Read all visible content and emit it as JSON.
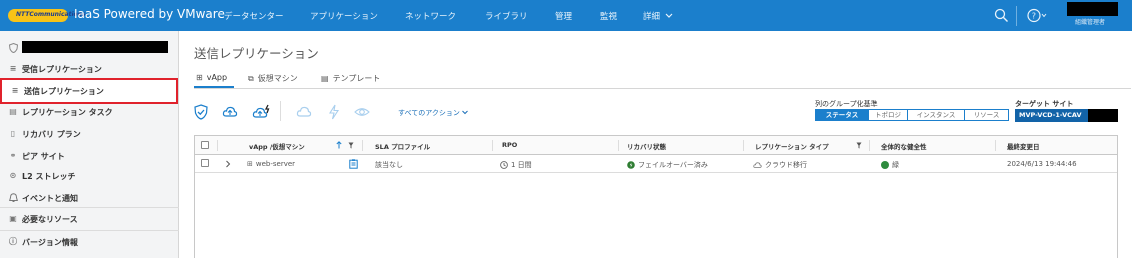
{
  "header": {
    "logo_text": "NTTCommunications",
    "app_title": "IaaS Powered by VMware",
    "nav": [
      "データセンター",
      "アプリケーション",
      "ネットワーク",
      "ライブラリ",
      "管理",
      "監視",
      "詳細"
    ],
    "user_role": "組織管理者"
  },
  "sidebar": {
    "items": [
      {
        "label": "受信レプリケーション",
        "icon": "inbound-icon"
      },
      {
        "label": "送信レプリケーション",
        "icon": "outbound-icon"
      },
      {
        "label": "レプリケーション タスク",
        "icon": "task-icon"
      },
      {
        "label": "リカバリ プラン",
        "icon": "plan-icon"
      },
      {
        "label": "ピア サイト",
        "icon": "peer-icon"
      },
      {
        "label": "L2 ストレッチ",
        "icon": "stretch-icon"
      },
      {
        "label": "イベントと通知",
        "icon": "bell-icon"
      },
      {
        "label": "必要なリソース",
        "icon": "resource-icon"
      },
      {
        "label": "バージョン情報",
        "icon": "info-icon"
      }
    ]
  },
  "main": {
    "title": "送信レプリケーション",
    "tabs": [
      "vApp",
      "仮想マシン",
      "テンプレート"
    ],
    "all_actions": "すべてのアクション",
    "group_by_label": "列のグループ化基準",
    "group_by_options": [
      "ステータス",
      "トポロジ",
      "インスタンス",
      "リソース"
    ],
    "target_site_label": "ターゲット サイト",
    "target_site_value": "MVP-VCD-1-VCAV"
  },
  "grid": {
    "columns": [
      "vApp /仮想マシン",
      "SLA プロファイル",
      "RPO",
      "リカバリ状態",
      "レプリケーション タイプ",
      "全体的な健全性",
      "最終変更日"
    ],
    "rows": [
      {
        "name": "web-server",
        "sla": "該当なし",
        "rpo": "1 日間",
        "recovery_state": "フェイルオーバー済み",
        "replication_type": "クラウド移行",
        "health": "緑",
        "last_modified": "2024/6/13 19:44:46"
      }
    ]
  },
  "colors": {
    "header": "#1b7fcc",
    "accent": "#1b7fcc",
    "selected_outline": "#e0222c",
    "health_green": "#2e8b3e"
  }
}
